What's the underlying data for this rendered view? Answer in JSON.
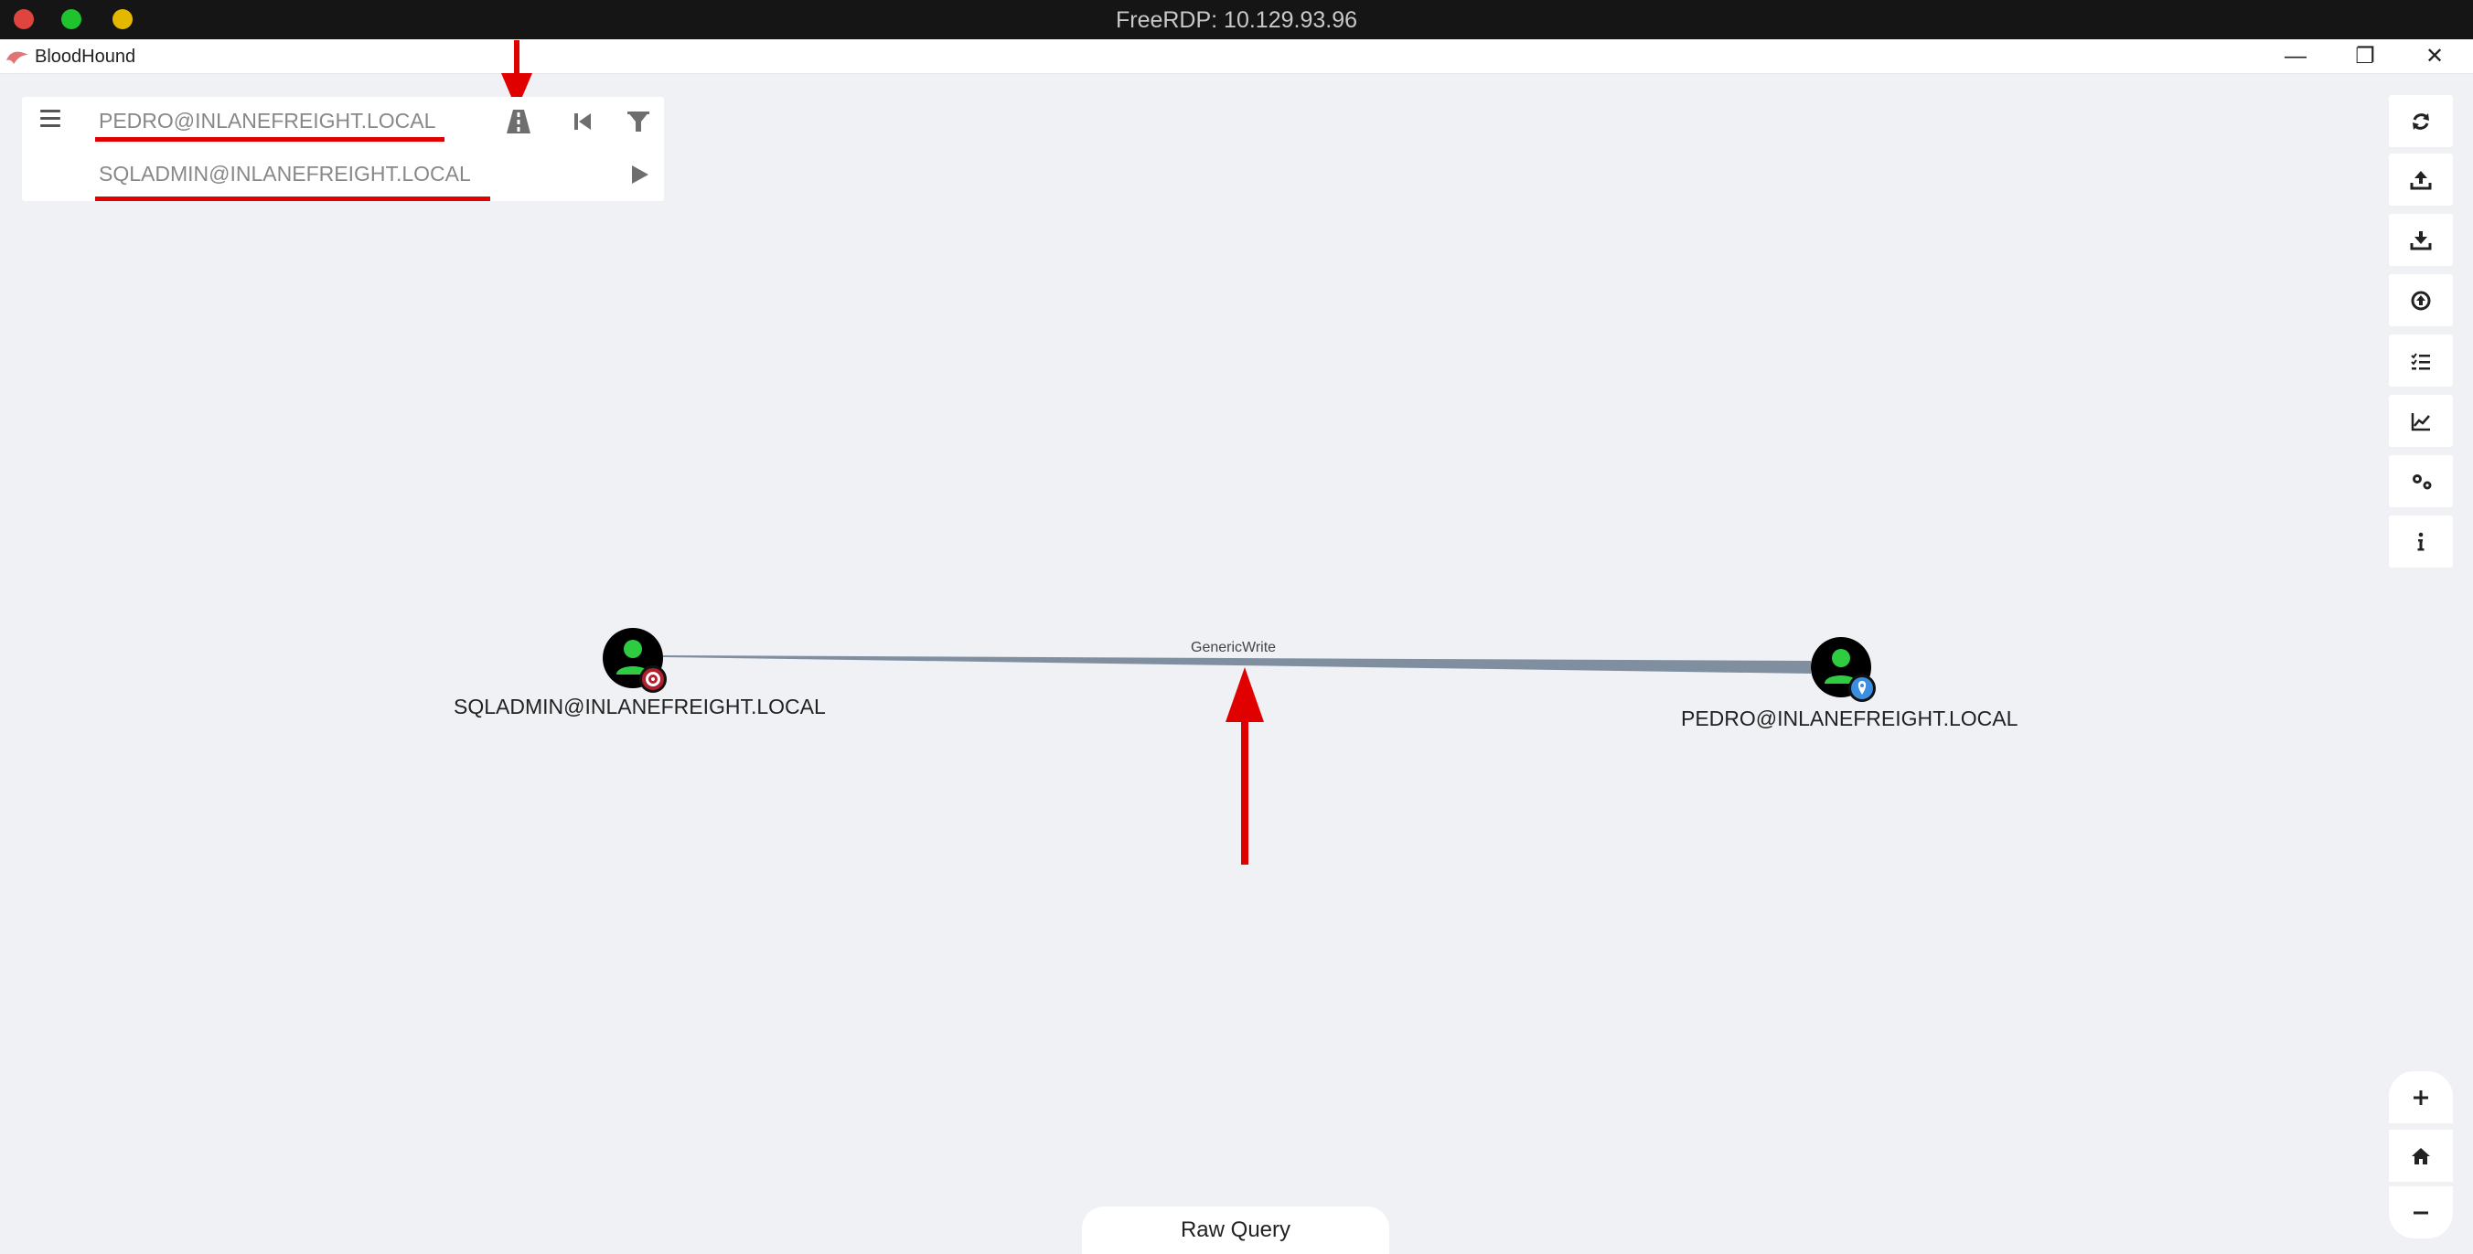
{
  "rdp": {
    "title": "FreeRDP: 10.129.93.96"
  },
  "app": {
    "title": "BloodHound",
    "window_controls": {
      "minimize": "—",
      "maximize": "❐",
      "close": "✕"
    }
  },
  "search": {
    "start_node": "PEDRO@INLANEFREIGHT.LOCAL",
    "target_node": "SQLADMIN@INLANEFREIGHT.LOCAL",
    "icons": [
      "menu-icon",
      "pathfinding-icon",
      "back-icon",
      "filter-icon",
      "play-icon"
    ]
  },
  "right_toolbar": {
    "icons": [
      "refresh-icon",
      "upload-icon",
      "download-icon",
      "import-icon",
      "queries-icon",
      "graph-stats-icon",
      "settings-icon",
      "info-icon"
    ]
  },
  "graph": {
    "nodes": [
      {
        "id": "sqladmin",
        "label": "SQLADMIN@INLANEFREIGHT.LOCAL",
        "type": "user",
        "badge": "target"
      },
      {
        "id": "pedro",
        "label": "PEDRO@INLANEFREIGHT.LOCAL",
        "type": "user",
        "badge": "owned-location"
      }
    ],
    "edges": [
      {
        "from": "pedro",
        "to": "sqladmin",
        "label": "GenericWrite"
      }
    ]
  },
  "zoom": {
    "plus": "+",
    "minus": "−"
  },
  "bottom": {
    "raw_query_label": "Raw Query"
  },
  "colors": {
    "annotation_red": "#e00000",
    "node_green": "#2ecc40",
    "edge": "#7f8fa0"
  }
}
